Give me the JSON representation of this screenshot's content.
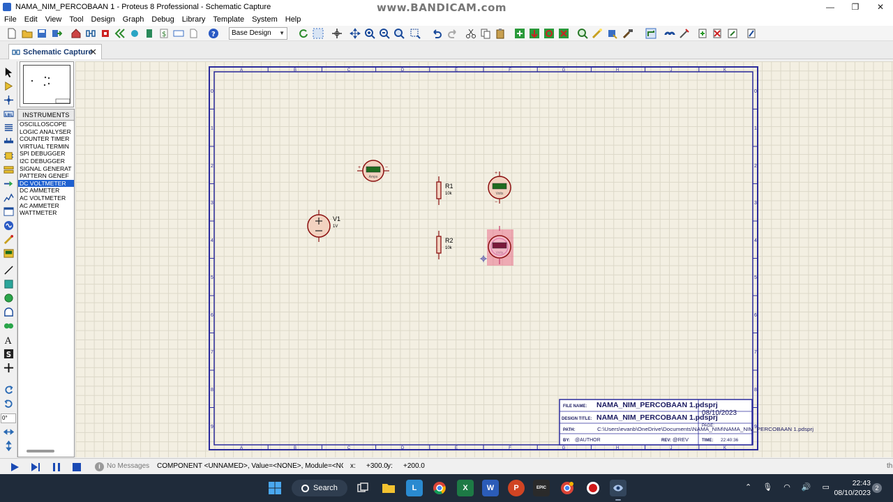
{
  "window": {
    "title": "NAMA_NIM_PERCOBAAN 1 - Proteus 8 Professional - Schematic Capture",
    "watermark": "www.BANDICAM.com",
    "minimize": "—",
    "maximize": "❐",
    "close": "✕"
  },
  "menu": [
    "File",
    "Edit",
    "View",
    "Tool",
    "Design",
    "Graph",
    "Debug",
    "Library",
    "Template",
    "System",
    "Help"
  ],
  "toolbar": {
    "variant": "Base Design"
  },
  "tabs": [
    {
      "label": "Schematic Capture",
      "close": "✕"
    }
  ],
  "left_tools": {
    "rotation_value": "0°"
  },
  "instruments": {
    "header": "INSTRUMENTS",
    "items": [
      "OSCILLOSCOPE",
      "LOGIC ANALYSER",
      "COUNTER TIMER",
      "VIRTUAL TERMIN",
      "SPI DEBUGGER",
      "I2C DEBUGGER",
      "SIGNAL GENERAT",
      "PATTERN GENEF",
      "DC VOLTMETER",
      "DC AMMETER",
      "AC VOLTMETER",
      "AC AMMETER",
      "WATTMETER"
    ],
    "selected_index": 8
  },
  "sheet": {
    "columns": [
      "A",
      "B",
      "C",
      "D",
      "E",
      "F",
      "G",
      "H",
      "J",
      "K"
    ],
    "rows": [
      "0",
      "1",
      "2",
      "3",
      "4",
      "5",
      "6",
      "7",
      "8",
      "9"
    ]
  },
  "components": {
    "v1": {
      "ref": "V1",
      "value": "1V"
    },
    "r1": {
      "ref": "R1",
      "value": "10k"
    },
    "r2": {
      "ref": "R2",
      "value": "10k"
    },
    "ammeter": {
      "label": "Amps",
      "plus": "+",
      "minus": "−"
    },
    "voltmeter1": {
      "label": "Volts",
      "plus": "+",
      "minus": "−"
    },
    "voltmeter2": {
      "label": "Volts"
    }
  },
  "title_block": {
    "file_name_label": "FILE NAME:",
    "file_name": "NAMA_NIM_PERCOBAAN 1.pdsprj",
    "date": "08/10/2023",
    "design_title_label": "DESIGN TITLE:",
    "design_title": "NAMA_NIM_PERCOBAAN 1.pdsprj",
    "path_label": "PATH:",
    "path": "C:\\Users\\evanb\\OneDrive\\Documents\\NAMA_NIM\\NAMA_NIM_PERCOBAAN 1.pdsprj",
    "page_label": "PAGE:",
    "by_label": "BY:",
    "author": "@AUTHOR",
    "rev_label": "REV:",
    "rev": "@REV",
    "time_label": "TIME:",
    "time": "22:40:36"
  },
  "status": {
    "messages": "No Messages",
    "text": "COMPONENT <UNNAMED>, Value=<NONE>, Module=<NONE>, D",
    "x_label": "x:",
    "x": "+300.0",
    "y_label": "y:",
    "y": "+200.0",
    "trail": "th"
  },
  "taskbar": {
    "search": "Search",
    "time": "22:43",
    "date": "08/10/2023",
    "badge": "2"
  },
  "colors": {
    "sheet_border": "#2b2b9c",
    "component": "#8b1010",
    "meter_display": "#1f6b1f",
    "selection": "#e8577a",
    "canvas": "#f3efe2"
  }
}
